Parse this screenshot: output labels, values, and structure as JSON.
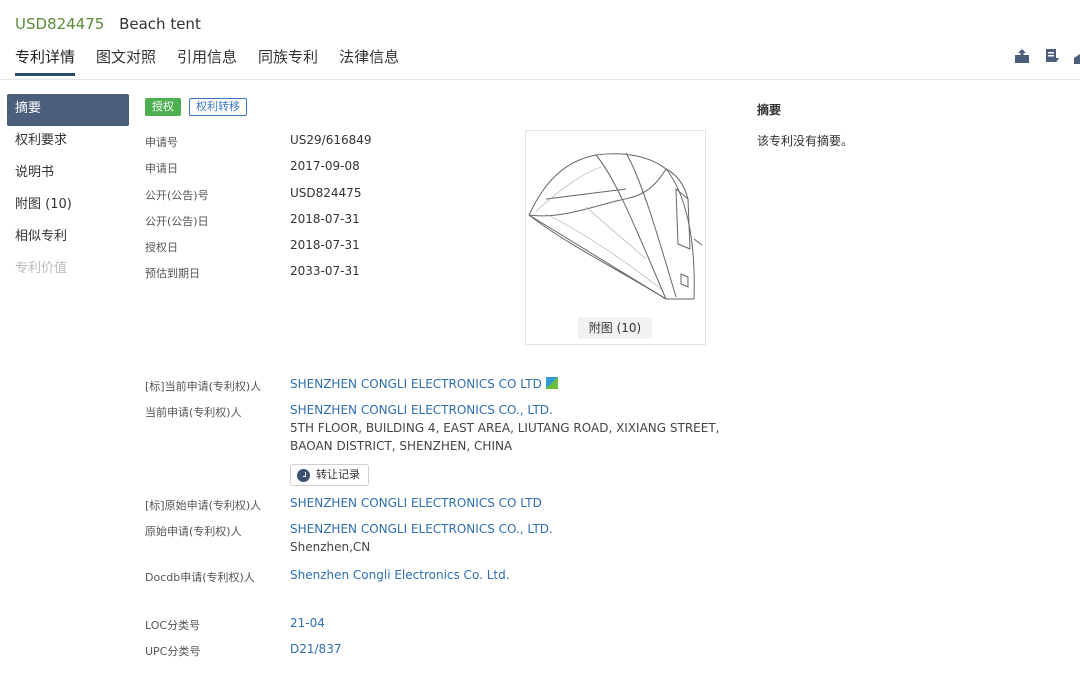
{
  "header": {
    "patent_number": "USD824475",
    "patent_title": "Beach tent",
    "tabs": [
      "专利详情",
      "图文对照",
      "引用信息",
      "同族专利",
      "法律信息"
    ]
  },
  "sidebar": {
    "items": [
      "摘要",
      "权利要求",
      "说明书",
      "附图 (10)",
      "相似专利",
      "专利价值"
    ]
  },
  "badges": {
    "granted": "授权",
    "transfer": "权利转移"
  },
  "fields": {
    "app_no_label": "申请号",
    "app_no": "US29/616849",
    "app_date_label": "申请日",
    "app_date": "2017-09-08",
    "pub_no_label": "公开(公告)号",
    "pub_no": "USD824475",
    "pub_date_label": "公开(公告)日",
    "pub_date": "2018-07-31",
    "grant_date_label": "授权日",
    "grant_date": "2018-07-31",
    "expiry_label": "预估到期日",
    "expiry": "2033-07-31",
    "std_current_label": "[标]当前申请(专利权)人",
    "std_current": "SHENZHEN CONGLI ELECTRONICS CO LTD",
    "current_label": "当前申请(专利权)人",
    "current": "SHENZHEN CONGLI ELECTRONICS CO., LTD.",
    "current_addr1": "5TH FLOOR, BUILDING 4, EAST AREA, LIUTANG ROAD, XIXIANG STREET,",
    "current_addr2": "BAOAN DISTRICT, SHENZHEN, CHINA",
    "transfer_record": "转让记录",
    "std_original_label": "[标]原始申请(专利权)人",
    "std_original": "SHENZHEN CONGLI ELECTRONICS CO LTD",
    "original_label": "原始申请(专利权)人",
    "original": "SHENZHEN CONGLI ELECTRONICS CO., LTD.",
    "original_loc": "Shenzhen,CN",
    "docdb_label": "Docdb申请(专利权)人",
    "docdb": "Shenzhen Congli Electronics Co. Ltd.",
    "loc_label": "LOC分类号",
    "loc": "21-04",
    "upc_label": "UPC分类号",
    "upc": "D21/837"
  },
  "figure": {
    "button": "附图 (10)"
  },
  "abstract": {
    "title": "摘要",
    "text": "该专利没有摘要。"
  }
}
